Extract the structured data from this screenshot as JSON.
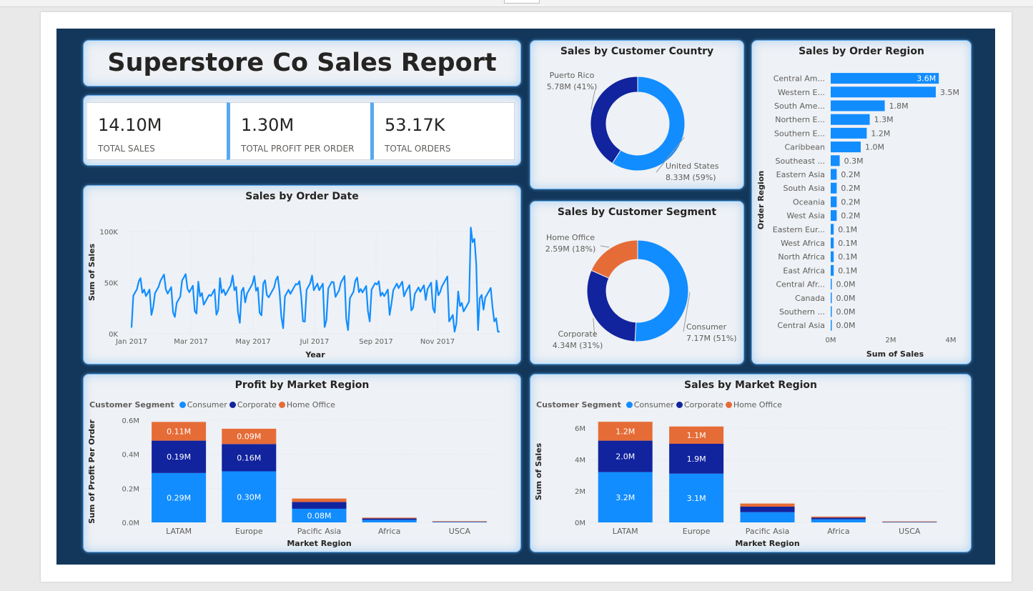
{
  "report": {
    "title": "Superstore Co Sales Report"
  },
  "kpis": [
    {
      "value": "14.10M",
      "label": "TOTAL SALES"
    },
    {
      "value": "1.30M",
      "label": "TOTAL PROFIT PER ORDER"
    },
    {
      "value": "53.17K",
      "label": "TOTAL ORDERS"
    }
  ],
  "colors": {
    "consumer": "#118dff",
    "corporate": "#12239e",
    "home_office": "#e66c37",
    "canvas": "#13375a",
    "card": "#eef1f5"
  },
  "chart_data": [
    {
      "id": "country",
      "type": "pie",
      "title": "Sales by Customer Country",
      "slices": [
        {
          "name": "United States",
          "value": 8.33,
          "label": "8.33M (59%)"
        },
        {
          "name": "Puerto Rico",
          "value": 5.78,
          "label": "5.78M (41%)"
        }
      ]
    },
    {
      "id": "segment",
      "type": "pie",
      "title": "Sales by Customer Segment",
      "slices": [
        {
          "name": "Consumer",
          "value": 7.17,
          "label": "7.17M (51%)"
        },
        {
          "name": "Corporate",
          "value": 4.34,
          "label": "4.34M (31%)"
        },
        {
          "name": "Home Office",
          "value": 2.59,
          "label": "2.59M (18%)"
        }
      ]
    },
    {
      "id": "region",
      "type": "bar",
      "orientation": "horizontal",
      "title": "Sales by Order Region",
      "xlabel": "Sum of Sales",
      "ylabel": "Order Region",
      "xticks": [
        "0M",
        "2M",
        "4M"
      ],
      "xlim": [
        0,
        4
      ],
      "categories": [
        "Central Am...",
        "Western E...",
        "South Ame...",
        "Northern E...",
        "Southern E...",
        "Caribbean",
        "Southeast ...",
        "Eastern Asia",
        "South Asia",
        "Oceania",
        "West Asia",
        "Eastern Eur...",
        "West Africa",
        "North Africa",
        "East Africa",
        "Central Afr...",
        "Canada",
        "Southern ...",
        "Central Asia"
      ],
      "values": [
        3.6,
        3.5,
        1.8,
        1.3,
        1.2,
        1.0,
        0.3,
        0.2,
        0.2,
        0.2,
        0.2,
        0.1,
        0.1,
        0.1,
        0.1,
        0.0,
        0.0,
        0.0,
        0.0
      ],
      "labels": [
        "3.6M",
        "3.5M",
        "1.8M",
        "1.3M",
        "1.2M",
        "1.0M",
        "0.3M",
        "0.2M",
        "0.2M",
        "0.2M",
        "0.2M",
        "0.1M",
        "0.1M",
        "0.1M",
        "0.1M",
        "0.0M",
        "0.0M",
        "0.0M",
        "0.0M"
      ]
    },
    {
      "id": "orderdate",
      "type": "line",
      "title": "Sales by Order Date",
      "xlabel": "Year",
      "ylabel": "Sum of Sales",
      "xticks": [
        "Jan 2017",
        "Mar 2017",
        "May 2017",
        "Jul 2017",
        "Sep 2017",
        "Nov 2017"
      ],
      "yticks": [
        "0K",
        "50K",
        "100K"
      ],
      "ylim": [
        0,
        100000
      ],
      "x_start": "2017-01-01",
      "x_end": "2017-12-31",
      "weekly_values": [
        42000,
        48000,
        40000,
        46000,
        50000,
        44000,
        38000,
        52000,
        47000,
        43000,
        30000,
        45000,
        48000,
        41000,
        49000,
        37000,
        44000,
        50000,
        46000,
        42000,
        48000,
        35000,
        47000,
        45000,
        43000,
        49000,
        41000,
        46000,
        44000,
        50000,
        38000,
        47000,
        42000,
        48000,
        45000,
        40000,
        49000,
        43000,
        46000,
        47000,
        41000,
        50000,
        44000,
        48000,
        20000,
        35000,
        25000,
        96000,
        30000,
        40000,
        20000,
        15000
      ]
    },
    {
      "id": "profit",
      "type": "bar",
      "title": "Profit by Market Region",
      "xlabel": "Market Region",
      "ylabel": "Sum of Profit Per Order",
      "legend_title": "Customer Segment",
      "categories": [
        "LATAM",
        "Europe",
        "Pacific Asia",
        "Africa",
        "USCA"
      ],
      "yticks": [
        "0.0M",
        "0.2M",
        "0.4M",
        "0.6M"
      ],
      "ylim": [
        0,
        0.6
      ],
      "series": [
        {
          "name": "Consumer",
          "values": [
            0.29,
            0.3,
            0.08,
            0.015,
            0.004
          ],
          "labels": [
            "0.29M",
            "0.30M",
            "0.08M",
            "",
            ""
          ]
        },
        {
          "name": "Corporate",
          "values": [
            0.19,
            0.16,
            0.04,
            0.008,
            0.002
          ],
          "labels": [
            "0.19M",
            "0.16M",
            "",
            "",
            ""
          ]
        },
        {
          "name": "Home Office",
          "values": [
            0.11,
            0.09,
            0.02,
            0.005,
            0.001
          ],
          "labels": [
            "0.11M",
            "0.09M",
            "",
            "",
            ""
          ]
        }
      ]
    },
    {
      "id": "sales",
      "type": "bar",
      "title": "Sales by Market Region",
      "xlabel": "Market Region",
      "ylabel": "Sum of Sales",
      "legend_title": "Customer Segment",
      "categories": [
        "LATAM",
        "Europe",
        "Pacific Asia",
        "Africa",
        "USCA"
      ],
      "yticks": [
        "0M",
        "2M",
        "4M",
        "6M"
      ],
      "ylim": [
        0,
        6.5
      ],
      "series": [
        {
          "name": "Consumer",
          "values": [
            3.2,
            3.1,
            0.65,
            0.2,
            0.03
          ],
          "labels": [
            "3.2M",
            "3.1M",
            "",
            "",
            ""
          ]
        },
        {
          "name": "Corporate",
          "values": [
            2.0,
            1.9,
            0.35,
            0.1,
            0.02
          ],
          "labels": [
            "2.0M",
            "1.9M",
            "",
            "",
            ""
          ]
        },
        {
          "name": "Home Office",
          "values": [
            1.2,
            1.1,
            0.2,
            0.07,
            0.01
          ],
          "labels": [
            "1.2M",
            "1.1M",
            "",
            "",
            ""
          ]
        }
      ]
    }
  ]
}
